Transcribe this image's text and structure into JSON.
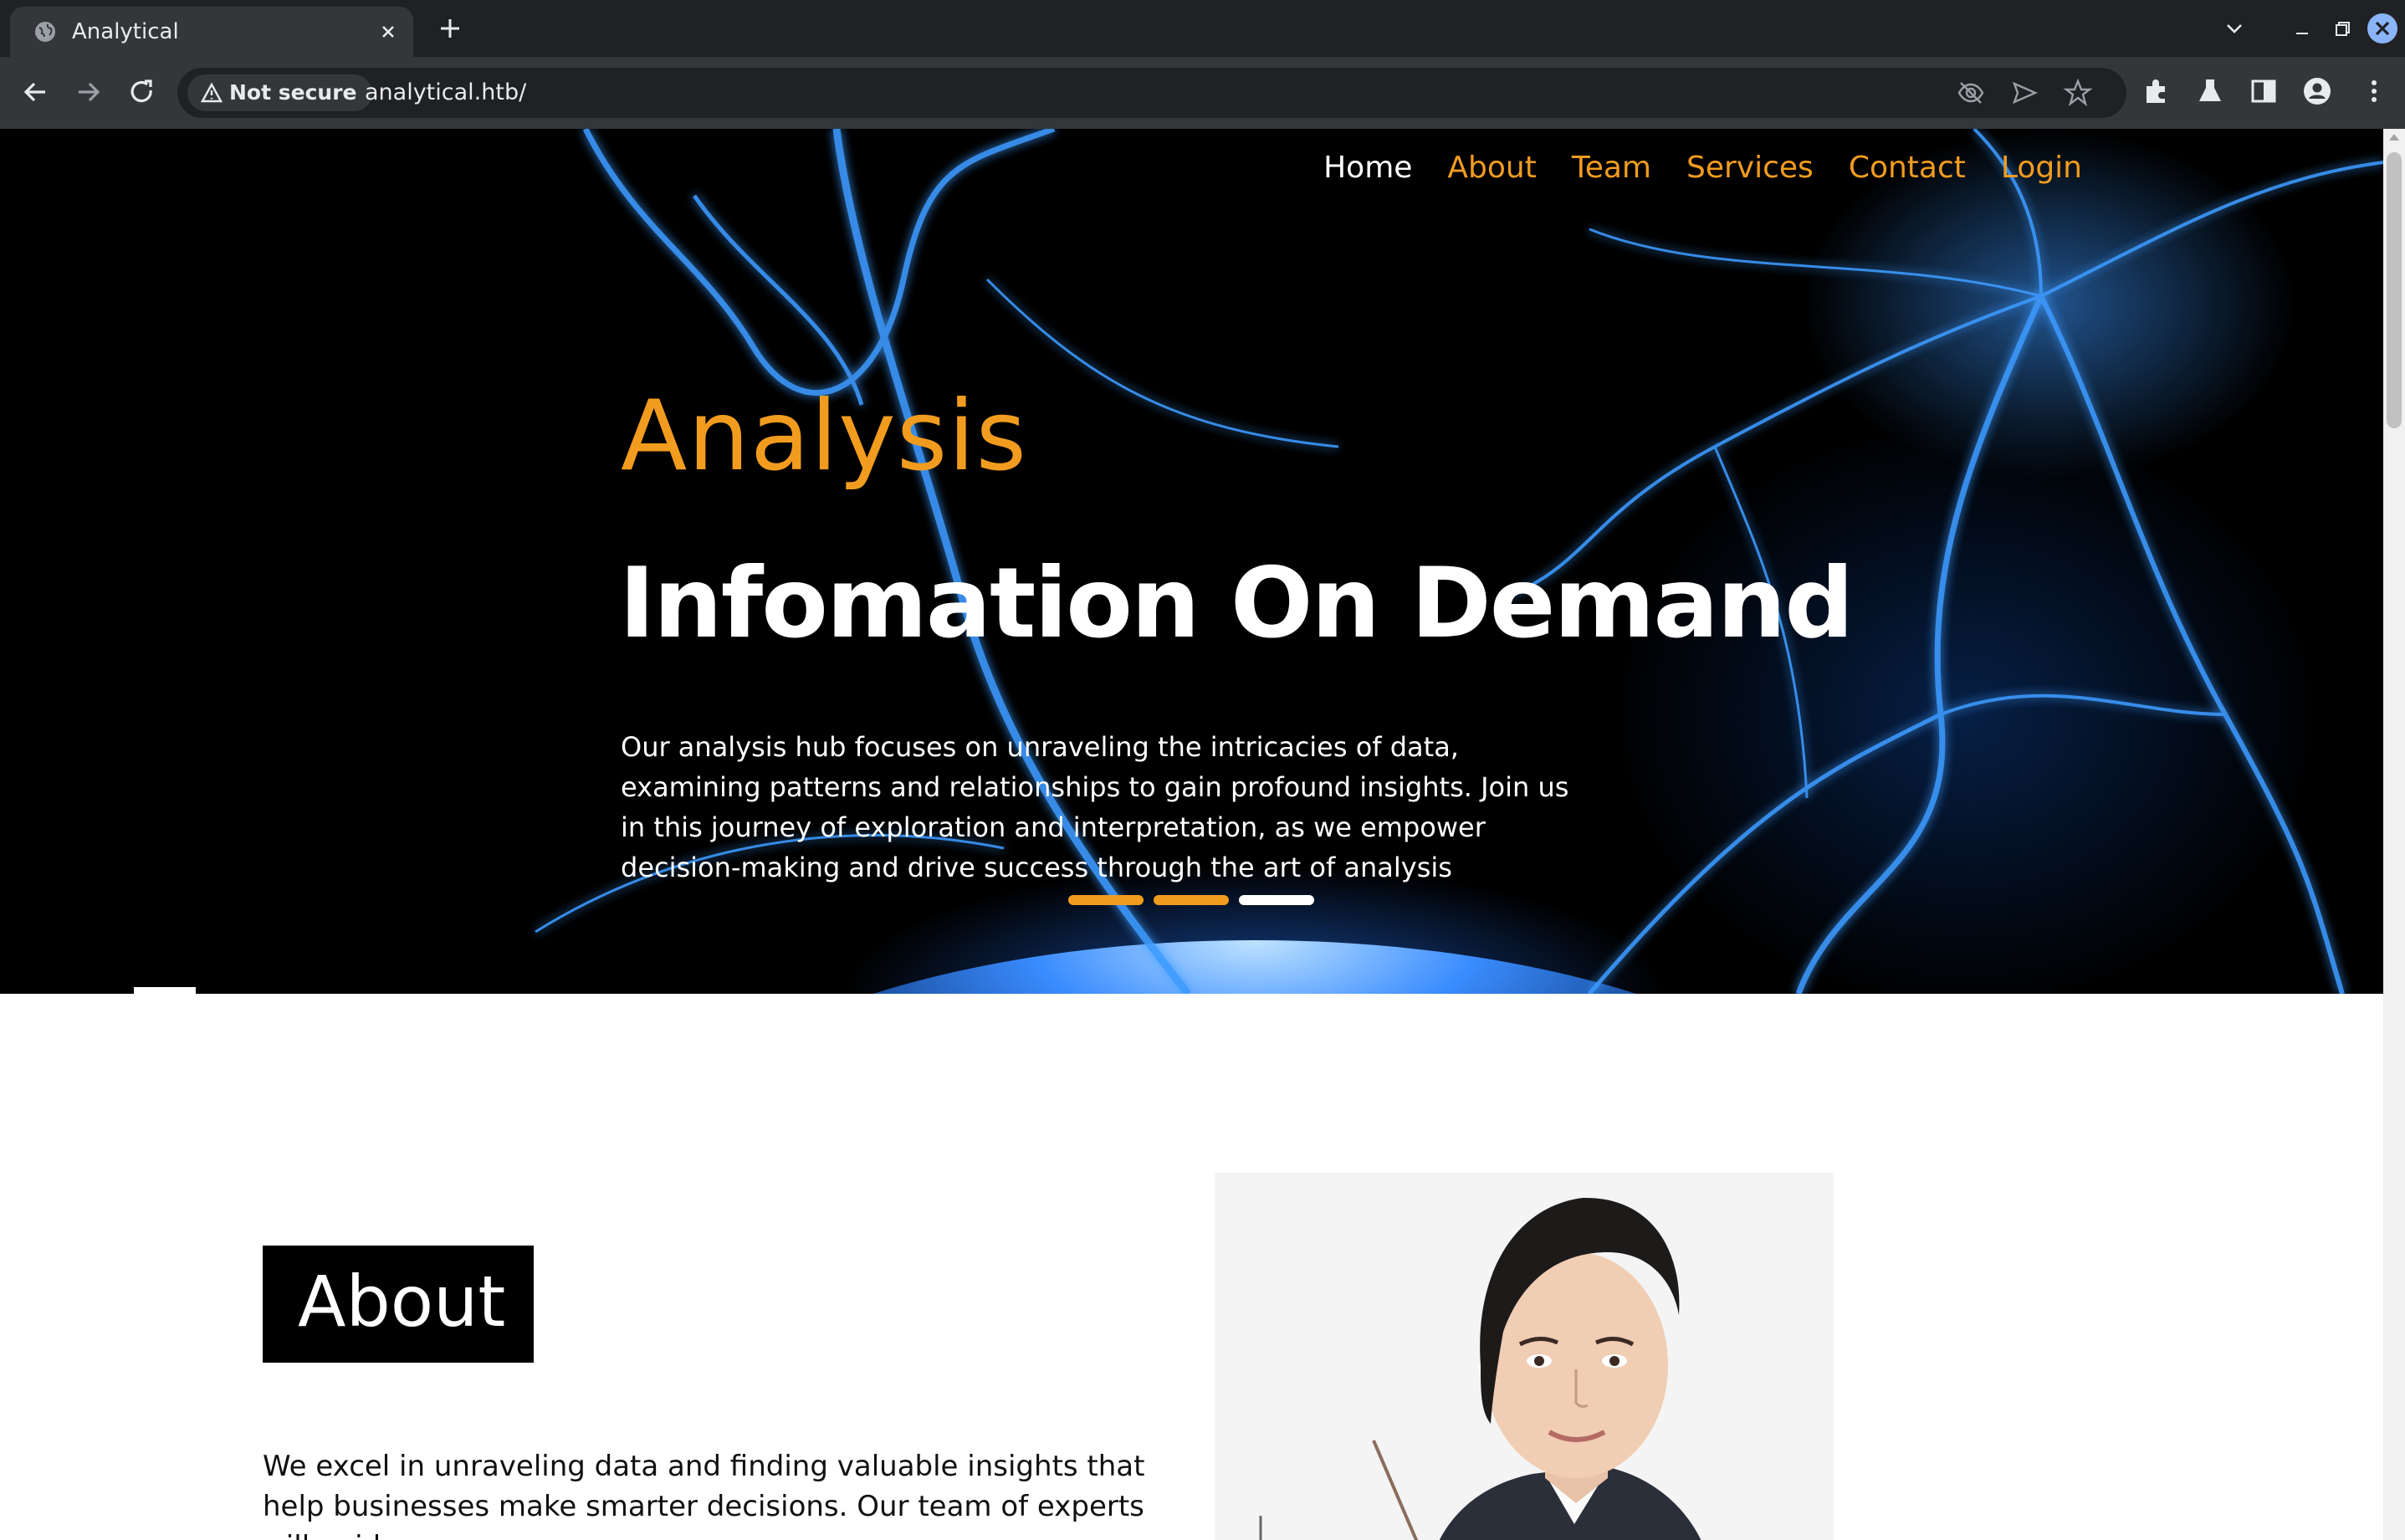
{
  "browser": {
    "tab_title": "Analytical",
    "security_label": "Not secure",
    "url": "analytical.htb/"
  },
  "nav": {
    "links": [
      "Home",
      "About",
      "Team",
      "Services",
      "Contact",
      "Login"
    ],
    "active": "Home"
  },
  "hero": {
    "subtitle": "Analysis",
    "title": "Infomation On Demand",
    "text": "Our analysis hub focuses on unraveling the intricacies of data, examining patterns and relationships to gain profound insights. Join us in this journey of exploration and interpretation, as we empower decision-making and drive success through the art of analysis",
    "slides": 3,
    "active_slide": 3
  },
  "about": {
    "heading": "About",
    "text": "We excel in unraveling data and finding valuable insights that help businesses make smarter decisions. Our team of experts will guide"
  },
  "colors": {
    "accent": "#f29c1f",
    "hero_bg": "#000000",
    "plasma": "#2f8cff"
  },
  "icons": {
    "favicon": "globe-icon",
    "back": "arrow-left-icon",
    "forward": "arrow-right-icon",
    "reload": "reload-icon",
    "security": "warning-triangle-icon",
    "omnibox": [
      "eye-slash-icon",
      "send-icon",
      "star-icon"
    ],
    "toolbar": [
      "extensions-icon",
      "labs-flask-icon",
      "side-panel-icon",
      "profile-icon",
      "kebab-menu-icon"
    ]
  }
}
